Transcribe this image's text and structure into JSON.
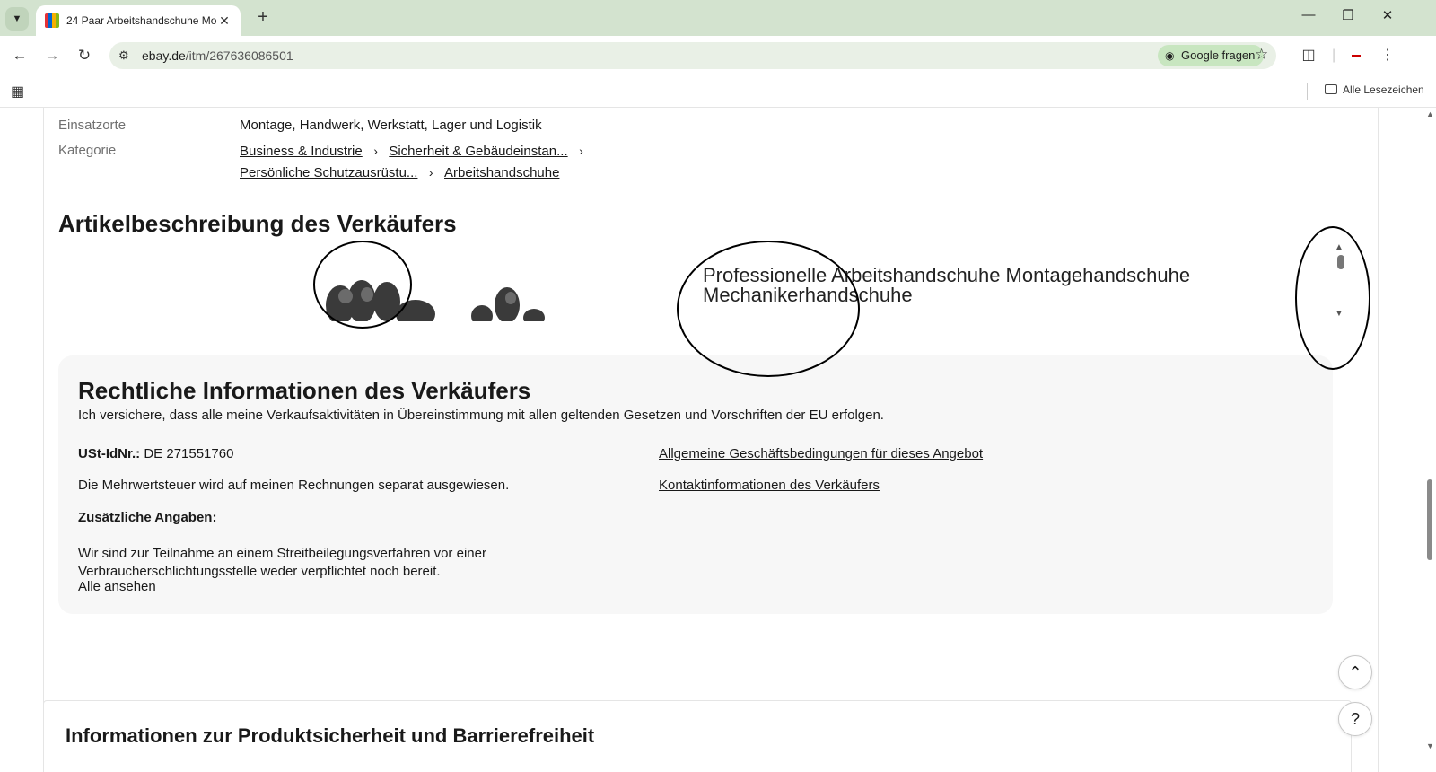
{
  "browser": {
    "tab_title": "24 Paar Arbeitshandschuhe Mo",
    "new_tab_label": "+",
    "url_host": "ebay.de",
    "url_path": "/itm/267636086501",
    "google_ask_label": "Google fragen",
    "bookmarks_all_label": "Alle Lesezeichen"
  },
  "specs": {
    "einsatzorte_label": "Einsatzorte",
    "einsatzorte_value": "Montage, Handwerk, Werkstatt, Lager und Logistik",
    "kategorie_label": "Kategorie",
    "breadcrumbs": [
      "Business & Industrie",
      "Sicherheit & Gebäudeinstan...",
      "Persönliche Schutzausrüstu...",
      "Arbeitshandschuhe"
    ]
  },
  "description": {
    "title": "Artikelbeschreibung des Verkäufers",
    "frame_text_line1": "Professionelle Arbeitshandschuhe Montagehandschuhe",
    "frame_text_line2": "Mechanikerhandschuhe"
  },
  "legal": {
    "title": "Rechtliche Informationen des Verkäufers",
    "compliance": "Ich versichere, dass alle meine Verkaufsaktivitäten in Übereinstimmung mit allen geltenden Gesetzen und Vorschriften der EU erfolgen.",
    "vat_label": "USt-IdNr.:",
    "vat_value": "DE 271551760",
    "vat_note": "Die Mehrwertsteuer wird auf meinen Rechnungen separat ausgewiesen.",
    "additional_label": "Zusätzliche Angaben:",
    "dispute_line1": "Wir sind zur Teilnahme an einem Streitbeilegungsverfahren vor einer",
    "dispute_line2": "Verbraucherschlichtungsstelle weder verpflichtet noch bereit.",
    "see_all_link": "Alle ansehen",
    "terms_link": "Allgemeine Geschäftsbedingungen für dieses Angebot",
    "contact_link": "Kontaktinformationen des Verkäufers"
  },
  "product_safety": {
    "title": "Informationen zur Produktsicherheit und Barrierefreiheit"
  },
  "floating": {
    "help_label": "?"
  },
  "icons": [
    "chevron-down-icon",
    "back-arrow-icon",
    "forward-arrow-icon",
    "reload-icon",
    "site-info-icon",
    "star-icon",
    "extensions-icon",
    "menu-dots-icon",
    "apps-grid-icon",
    "folder-icon",
    "chevron-up-icon"
  ]
}
